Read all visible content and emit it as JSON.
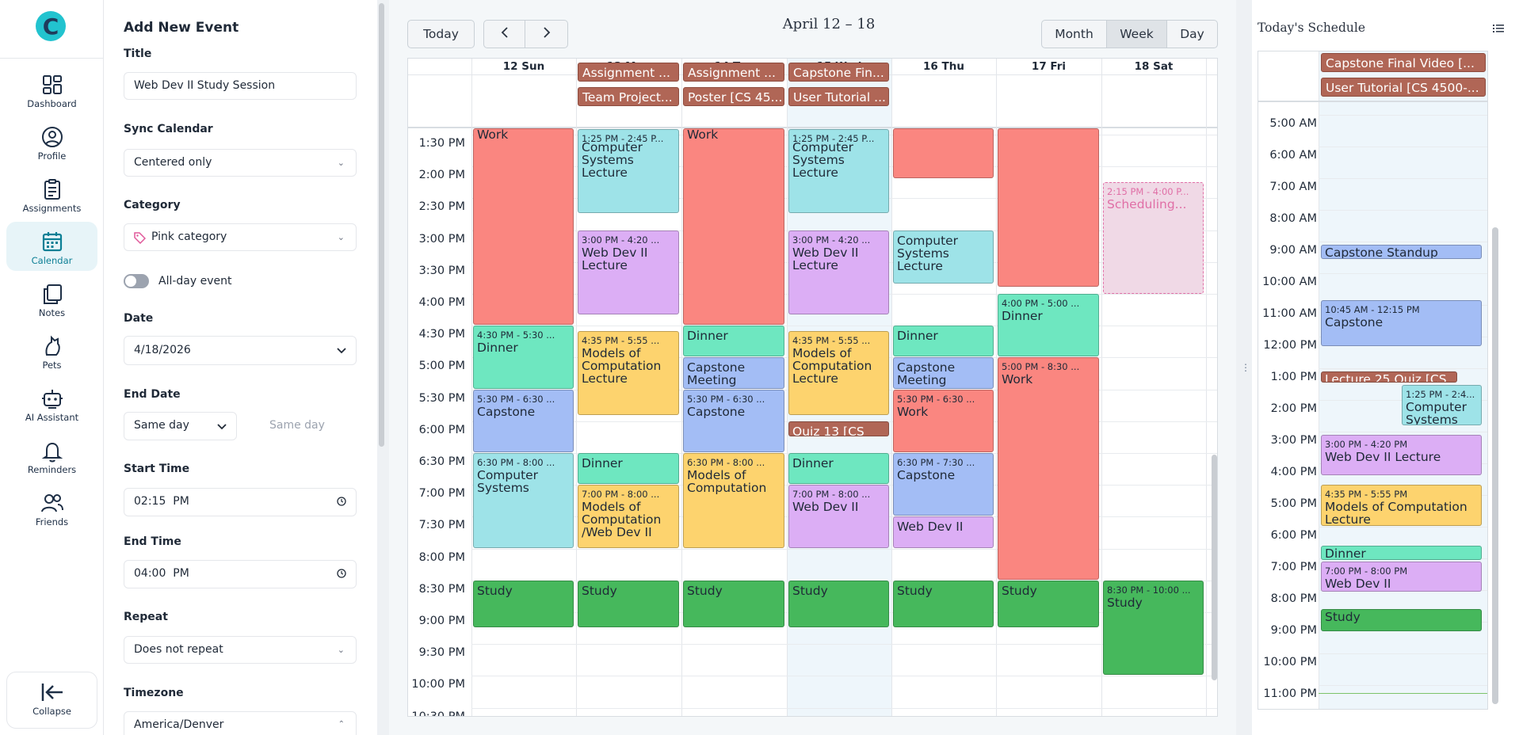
{
  "nav": {
    "items": [
      {
        "key": "dashboard",
        "label": "Dashboard",
        "active": false
      },
      {
        "key": "profile",
        "label": "Profile",
        "active": false
      },
      {
        "key": "assignments",
        "label": "Assignments",
        "active": false
      },
      {
        "key": "calendar",
        "label": "Calendar",
        "active": true
      },
      {
        "key": "notes",
        "label": "Notes",
        "active": false
      },
      {
        "key": "pets",
        "label": "Pets",
        "active": false
      },
      {
        "key": "ai",
        "label": "AI Assistant",
        "active": false
      },
      {
        "key": "reminders",
        "label": "Reminders",
        "active": false
      },
      {
        "key": "friends",
        "label": "Friends",
        "active": false
      }
    ],
    "collapse_label": "Collapse",
    "accent": "#0c7f95"
  },
  "form": {
    "heading": "Add New Event",
    "title_label": "Title",
    "title_value": "Web Dev II Study Session",
    "sync_label": "Sync Calendar",
    "sync_value": "Centered only",
    "category_label": "Category",
    "category_value": "Pink category",
    "allday_label": "All-day event",
    "allday_on": false,
    "date_label": "Date",
    "date_value": "4/18/2026",
    "enddate_label": "End Date",
    "enddate_value": "Same day",
    "enddate_hint": "Same day",
    "start_label": "Start Time",
    "start_value": "02:15  PM",
    "end_label": "End Time",
    "end_value": "04:00  PM",
    "repeat_label": "Repeat",
    "repeat_value": "Does not repeat",
    "tz_label": "Timezone",
    "tz_value": "America/Denver"
  },
  "calendar": {
    "today_btn": "Today",
    "range_title": "April 12 – 18",
    "views": [
      {
        "label": "Month",
        "active": false
      },
      {
        "label": "Week",
        "active": true
      },
      {
        "label": "Day",
        "active": false
      }
    ],
    "days": [
      "12 Sun",
      "13 Mon",
      "14 Tue",
      "15 Wed",
      "16 Thu",
      "17 Fri",
      "18 Sat"
    ],
    "times": [
      "1:30 PM",
      "2:00 PM",
      "2:30 PM",
      "3:00 PM",
      "3:30 PM",
      "4:00 PM",
      "4:30 PM",
      "5:00 PM",
      "5:30 PM",
      "6:00 PM",
      "6:30 PM",
      "7:00 PM",
      "7:30 PM",
      "8:00 PM",
      "8:30 PM",
      "9:00 PM",
      "9:30 PM",
      "10:00 PM",
      "10:30 PM"
    ],
    "allday": [
      {
        "day": 1,
        "row": 0,
        "label": "Assignment ..."
      },
      {
        "day": 1,
        "row": 1,
        "label": "Team Project..."
      },
      {
        "day": 2,
        "row": 0,
        "label": "Assignment ..."
      },
      {
        "day": 2,
        "row": 1,
        "label": "Poster [CS 45..."
      },
      {
        "day": 3,
        "row": 0,
        "label": "Capstone Fin..."
      },
      {
        "day": 3,
        "row": 1,
        "label": "User Tutorial ..."
      }
    ],
    "events": [
      {
        "day": 0,
        "s": 1.25,
        "e": 4.5,
        "color": "red",
        "time": "",
        "name": "Work"
      },
      {
        "day": 0,
        "s": 4.5,
        "e": 5.5,
        "color": "mint",
        "time": "4:30 PM - 5:30 ...",
        "name": "Dinner"
      },
      {
        "day": 0,
        "s": 5.5,
        "e": 6.5,
        "color": "blue",
        "time": "5:30 PM - 6:30 ...",
        "name": "Capstone"
      },
      {
        "day": 0,
        "s": 6.5,
        "e": 8.0,
        "color": "cyan",
        "time": "6:30 PM - 8:00 ...",
        "name": "Computer Systems"
      },
      {
        "day": 0,
        "s": 8.5,
        "e": 9.25,
        "color": "green",
        "time": "",
        "name": "Study"
      },
      {
        "day": 1,
        "s": 1.4167,
        "e": 2.75,
        "color": "cyan",
        "time": "1:25 PM - 2:45 P...",
        "name": "Computer Systems Lecture"
      },
      {
        "day": 1,
        "s": 3.0,
        "e": 4.3333,
        "color": "purple",
        "time": "3:00 PM - 4:20 ...",
        "name": "Web Dev II Lecture"
      },
      {
        "day": 1,
        "s": 4.5833,
        "e": 5.9167,
        "color": "yellow",
        "time": "4:35 PM - 5:55 ...",
        "name": "Models of Computation Lecture"
      },
      {
        "day": 1,
        "s": 6.5,
        "e": 7.0,
        "color": "mint",
        "time": "",
        "name": "Dinner"
      },
      {
        "day": 1,
        "s": 7.0,
        "e": 8.0,
        "color": "yellow",
        "time": "7:00 PM - 8:00 ...",
        "name": "Models of Computation /Web Dev II"
      },
      {
        "day": 1,
        "s": 8.5,
        "e": 9.25,
        "color": "green",
        "time": "",
        "name": "Study"
      },
      {
        "day": 2,
        "s": 1.25,
        "e": 4.5,
        "color": "red",
        "time": "",
        "name": "Work"
      },
      {
        "day": 2,
        "s": 4.5,
        "e": 5.0,
        "color": "mint",
        "time": "",
        "name": "Dinner"
      },
      {
        "day": 2,
        "s": 5.0,
        "e": 5.5,
        "color": "blue",
        "time": "",
        "name": "Capstone Meeting"
      },
      {
        "day": 2,
        "s": 5.5,
        "e": 6.5,
        "color": "blue",
        "time": "5:30 PM - 6:30 ...",
        "name": "Capstone"
      },
      {
        "day": 2,
        "s": 6.5,
        "e": 8.0,
        "color": "yellow",
        "time": "6:30 PM - 8:00 ...",
        "name": "Models of Computation"
      },
      {
        "day": 2,
        "s": 8.5,
        "e": 9.25,
        "color": "green",
        "time": "",
        "name": "Study"
      },
      {
        "day": 3,
        "s": 1.4167,
        "e": 2.75,
        "color": "cyan",
        "time": "1:25 PM - 2:45 P...",
        "name": "Computer Systems Lecture"
      },
      {
        "day": 3,
        "s": 3.0,
        "e": 4.3333,
        "color": "purple",
        "time": "3:00 PM - 4:20 ...",
        "name": "Web Dev II Lecture"
      },
      {
        "day": 3,
        "s": 4.5833,
        "e": 5.9167,
        "color": "yellow",
        "time": "4:35 PM - 5:55 ...",
        "name": "Models of Computation Lecture"
      },
      {
        "day": 3,
        "s": 6.0,
        "e": 6.25,
        "color": "brown",
        "time": "",
        "name": "Quiz 13 [CS"
      },
      {
        "day": 3,
        "s": 6.5,
        "e": 7.0,
        "color": "mint",
        "time": "",
        "name": "Dinner"
      },
      {
        "day": 3,
        "s": 7.0,
        "e": 8.0,
        "color": "purple",
        "time": "7:00 PM - 8:00 ...",
        "name": "Web Dev II"
      },
      {
        "day": 3,
        "s": 8.5,
        "e": 9.25,
        "color": "green",
        "time": "",
        "name": "Study"
      },
      {
        "day": 4,
        "s": 1.25,
        "e": 2.2,
        "color": "red",
        "time": "",
        "name": ""
      },
      {
        "day": 4,
        "s": 3.0,
        "e": 3.85,
        "color": "cyan",
        "time": "",
        "name": "Computer Systems Lecture"
      },
      {
        "day": 4,
        "s": 4.5,
        "e": 5.0,
        "color": "mint",
        "time": "",
        "name": "Dinner"
      },
      {
        "day": 4,
        "s": 5.0,
        "e": 5.5,
        "color": "blue",
        "time": "",
        "name": "Capstone Meeting"
      },
      {
        "day": 4,
        "s": 5.5,
        "e": 6.5,
        "color": "red",
        "time": "5:30 PM - 6:30 ...",
        "name": "Work"
      },
      {
        "day": 4,
        "s": 6.5,
        "e": 7.5,
        "color": "blue",
        "time": "6:30 PM - 7:30 ...",
        "name": "Capstone"
      },
      {
        "day": 4,
        "s": 7.5,
        "e": 8.0,
        "color": "purple",
        "time": "",
        "name": "Web Dev II"
      },
      {
        "day": 4,
        "s": 8.5,
        "e": 9.25,
        "color": "green",
        "time": "",
        "name": "Study"
      },
      {
        "day": 5,
        "s": 1.25,
        "e": 3.9,
        "color": "red",
        "time": "",
        "name": ""
      },
      {
        "day": 5,
        "s": 4.0,
        "e": 5.0,
        "color": "mint",
        "time": "4:00 PM - 5:00 ...",
        "name": "Dinner"
      },
      {
        "day": 5,
        "s": 5.0,
        "e": 8.5,
        "color": "red",
        "time": "5:00 PM - 8:30 ...",
        "name": "Work"
      },
      {
        "day": 5,
        "s": 8.5,
        "e": 9.25,
        "color": "green",
        "time": "",
        "name": "Study"
      },
      {
        "day": 6,
        "s": 8.5,
        "e": 10.0,
        "color": "green",
        "time": "8:30 PM - 10:00 ...",
        "name": "Study"
      }
    ],
    "draft": {
      "day": 6,
      "time": "2:15 PM - 4:00 P...",
      "name": "Scheduling..."
    }
  },
  "today": {
    "title": "Today's Schedule",
    "allday": [
      "Capstone Final Video [...",
      "User Tutorial [CS 4500-..."
    ],
    "times": [
      "5:00 AM",
      "6:00 AM",
      "7:00 AM",
      "8:00 AM",
      "9:00 AM",
      "10:00 AM",
      "11:00 AM",
      "12:00 PM",
      "1:00 PM",
      "2:00 PM",
      "3:00 PM",
      "4:00 PM",
      "5:00 PM",
      "6:00 PM",
      "7:00 PM",
      "8:00 PM",
      "9:00 PM",
      "10:00 PM",
      "11:00 PM"
    ],
    "events": [
      {
        "s": 9.0,
        "e": 9.5,
        "col": "full",
        "color": "blue",
        "time": "",
        "name": "Capstone Standup"
      },
      {
        "s": 10.75,
        "e": 12.25,
        "col": "full",
        "color": "blue",
        "time": "10:45 AM - 12:15 PM",
        "name": "Capstone"
      },
      {
        "s": 13.0,
        "e": 13.4,
        "col": "left",
        "color": "brown",
        "time": "",
        "name": "Lecture 25 Quiz [CS"
      },
      {
        "s": 13.4167,
        "e": 14.75,
        "col": "right",
        "color": "cyan",
        "time": "1:25 PM - 2:4...",
        "name": "Computer Systems"
      },
      {
        "s": 15.0,
        "e": 16.3333,
        "col": "full",
        "color": "purple",
        "time": "3:00 PM - 4:20 PM",
        "name": "Web Dev II Lecture"
      },
      {
        "s": 16.5833,
        "e": 17.9167,
        "col": "full",
        "color": "yellow",
        "time": "4:35 PM - 5:55 PM",
        "name": "Models of Computation Lecture"
      },
      {
        "s": 18.5,
        "e": 19.0,
        "col": "full",
        "color": "mint",
        "time": "",
        "name": "Dinner"
      },
      {
        "s": 19.0,
        "e": 20.0,
        "col": "full",
        "color": "purple",
        "time": "7:00 PM - 8:00 PM",
        "name": "Web Dev II"
      },
      {
        "s": 20.5,
        "e": 21.25,
        "col": "full",
        "color": "green",
        "time": "",
        "name": "Study"
      }
    ]
  }
}
